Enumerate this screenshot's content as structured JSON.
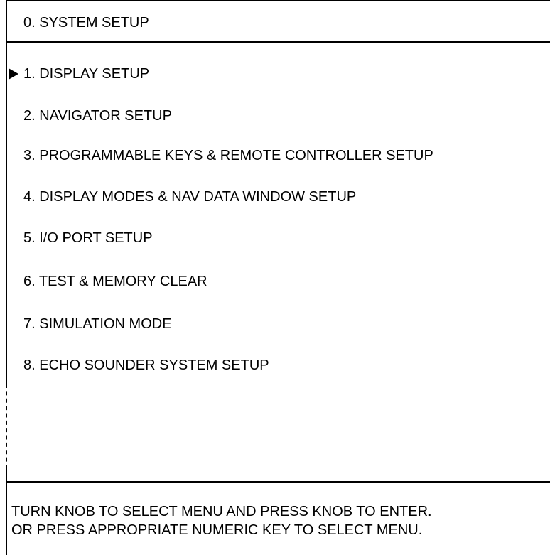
{
  "header": {
    "title": "0. SYSTEM SETUP"
  },
  "menu": {
    "selected_index": 0,
    "items": [
      {
        "label": "1. DISPLAY SETUP"
      },
      {
        "label": "2. NAVIGATOR SETUP"
      },
      {
        "label": "3. PROGRAMMABLE KEYS & REMOTE CONTROLLER SETUP"
      },
      {
        "label": "4. DISPLAY MODES & NAV DATA WINDOW SETUP"
      },
      {
        "label": "5. I/O PORT SETUP"
      },
      {
        "label": "6. TEST & MEMORY CLEAR"
      },
      {
        "label": "7. SIMULATION MODE"
      },
      {
        "label": "8. ECHO SOUNDER SYSTEM SETUP"
      }
    ]
  },
  "footer": {
    "line1": "TURN KNOB TO SELECT MENU AND PRESS KNOB TO ENTER.",
    "line2": "OR PRESS APPROPRIATE NUMERIC KEY TO SELECT MENU."
  },
  "icons": {
    "cursor": "selection-arrow-icon"
  },
  "colors": {
    "background": "#ffffff",
    "foreground": "#000000"
  }
}
